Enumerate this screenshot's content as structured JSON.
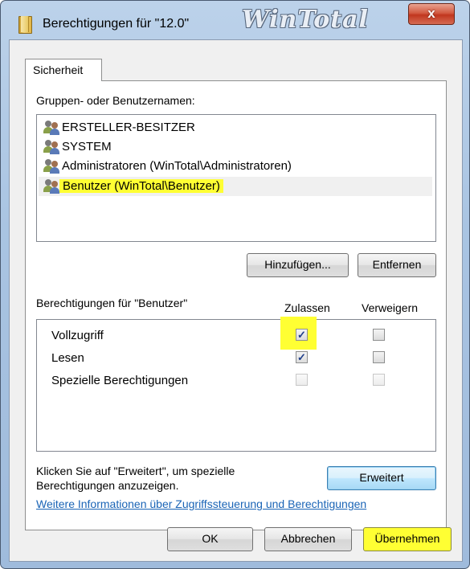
{
  "window": {
    "title": "Berechtigungen für \"12.0\"",
    "brand": "WinTotal",
    "close_label": "x"
  },
  "tabs": [
    {
      "label": "Sicherheit"
    }
  ],
  "groups": {
    "label": "Gruppen- oder Benutzernamen:",
    "items": [
      {
        "label": "ERSTELLER-BESITZER",
        "icon": "users-icon"
      },
      {
        "label": "SYSTEM",
        "icon": "users-icon"
      },
      {
        "label": "Administratoren (WinTotal\\Administratoren)",
        "icon": "users-icon"
      },
      {
        "label": "Benutzer (WinTotal\\Benutzer)",
        "icon": "users-icon",
        "selected": true
      }
    ],
    "add_button": "Hinzufügen...",
    "remove_button": "Entfernen"
  },
  "permissions": {
    "label": "Berechtigungen für \"Benutzer\"",
    "allow_header": "Zulassen",
    "deny_header": "Verweigern",
    "rows": [
      {
        "label": "Vollzugriff",
        "allow": true,
        "deny": false,
        "allow_disabled": false,
        "deny_disabled": false
      },
      {
        "label": "Lesen",
        "allow": true,
        "deny": false,
        "allow_disabled": false,
        "deny_disabled": false
      },
      {
        "label": "Spezielle Berechtigungen",
        "allow": false,
        "deny": false,
        "allow_disabled": true,
        "deny_disabled": true
      }
    ],
    "checkmark": "✓"
  },
  "advanced": {
    "hint_line1": "Klicken Sie auf \"Erweitert\", um spezielle",
    "hint_line2": "Berechtigungen anzuzeigen.",
    "button": "Erweitert"
  },
  "link": {
    "label": "Weitere Informationen über Zugriffssteuerung und Berechtigungen"
  },
  "footer": {
    "ok": "OK",
    "cancel": "Abbrechen",
    "apply": "Übernehmen"
  },
  "colors": {
    "highlight": "#ffff33",
    "link": "#1a64b6",
    "window_frame": "#a9c4e2",
    "close_button": "#c1371f"
  }
}
